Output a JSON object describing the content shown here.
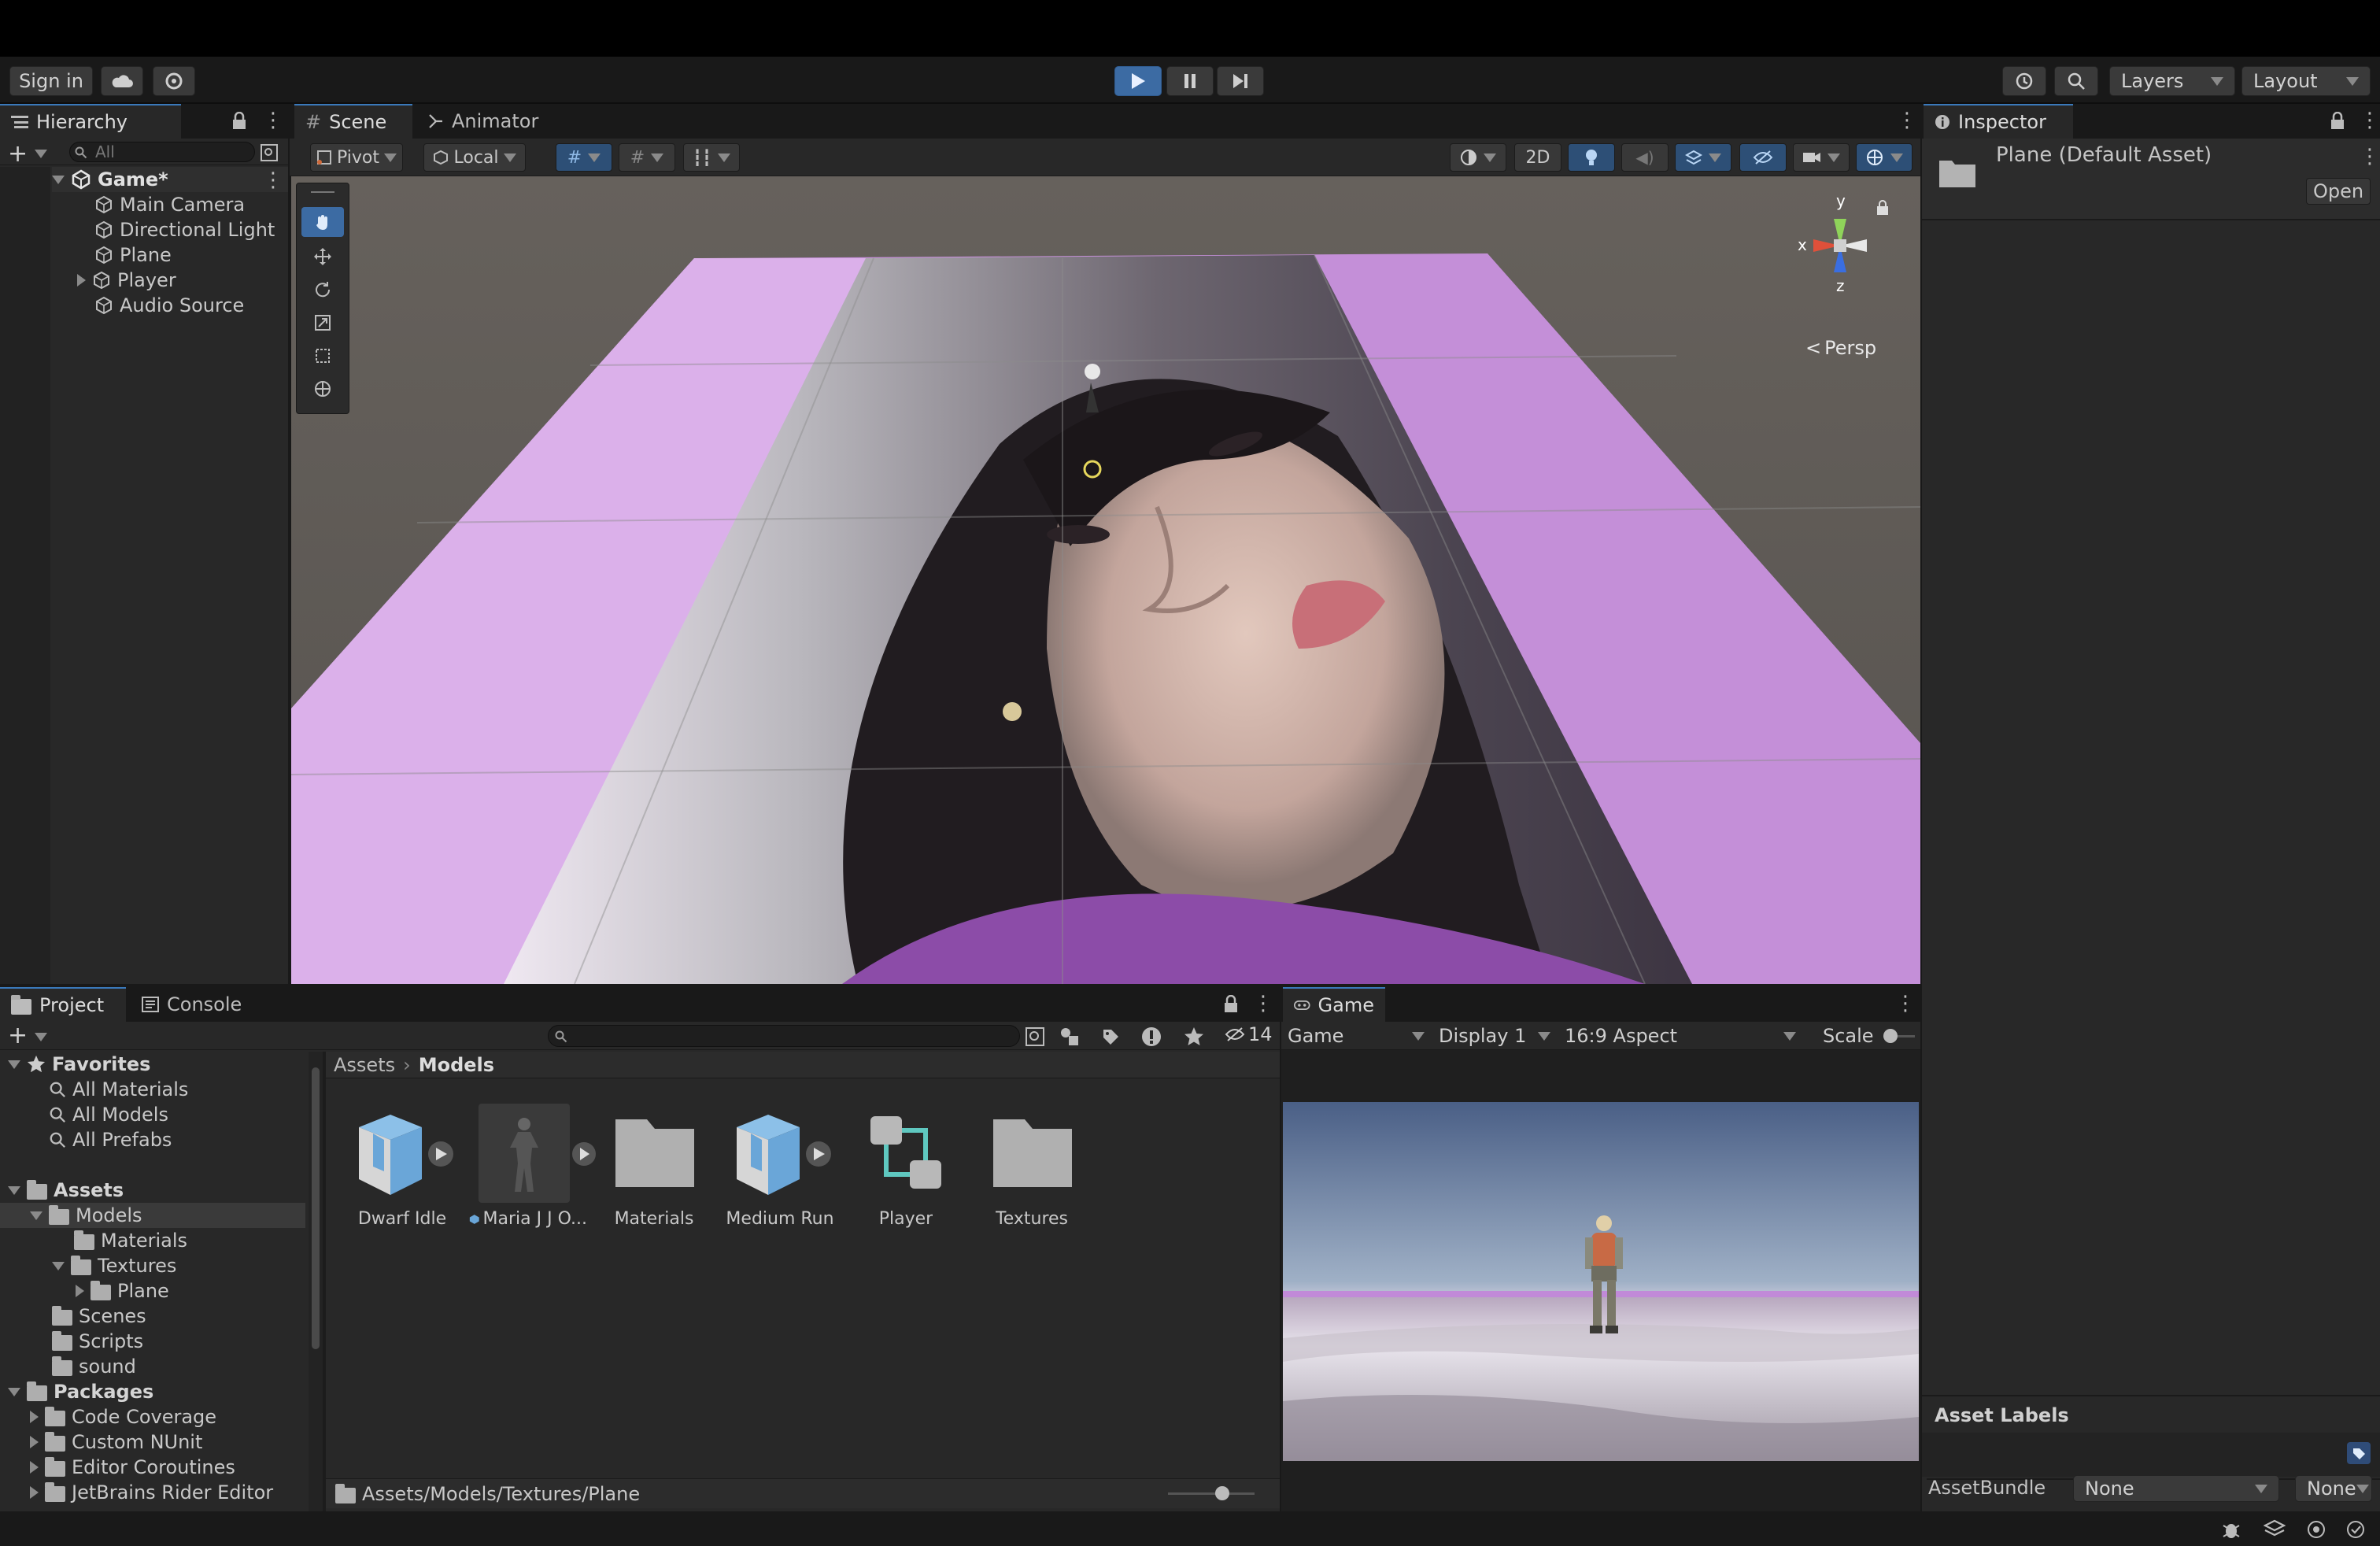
{
  "toolbar": {
    "sign_in": "Sign in",
    "layers": "Layers",
    "layout": "Layout"
  },
  "hierarchy": {
    "tab": "Hierarchy",
    "search_placeholder": "All",
    "scene": "Game*",
    "items": [
      {
        "label": "Main Camera"
      },
      {
        "label": "Directional Light"
      },
      {
        "label": "Plane"
      },
      {
        "label": "Player"
      },
      {
        "label": "Audio Source"
      }
    ]
  },
  "scene_view": {
    "tabs": [
      {
        "label": "Scene"
      },
      {
        "label": "Animator"
      }
    ],
    "pivot": "Pivot",
    "local": "Local",
    "two_d": "2D",
    "gizmo": {
      "x": "x",
      "y": "y",
      "z": "z",
      "persp": "Persp"
    },
    "colors": {
      "plane": "#c48fd8",
      "sky": "#5f5b57"
    }
  },
  "inspector": {
    "tab": "Inspector",
    "title": "Plane (Default Asset)",
    "open": "Open",
    "asset_labels": "Asset Labels",
    "asset_bundle": "AssetBundle",
    "bundle_value": "None",
    "variant_value": "None"
  },
  "project": {
    "tabs": [
      {
        "label": "Project"
      },
      {
        "label": "Console"
      }
    ],
    "hidden_count": "14",
    "favorites": {
      "label": "Favorites",
      "items": [
        {
          "label": "All Materials"
        },
        {
          "label": "All Models"
        },
        {
          "label": "All Prefabs"
        }
      ]
    },
    "assets_root": "Assets",
    "tree": [
      {
        "label": "Models"
      },
      {
        "label": "Materials"
      },
      {
        "label": "Textures"
      },
      {
        "label": "Plane"
      },
      {
        "label": "Scenes"
      },
      {
        "label": "Scripts"
      },
      {
        "label": "sound"
      }
    ],
    "packages": {
      "label": "Packages",
      "items": [
        {
          "label": "Code Coverage"
        },
        {
          "label": "Custom NUnit"
        },
        {
          "label": "Editor Coroutines"
        },
        {
          "label": "JetBrains Rider Editor"
        }
      ]
    },
    "breadcrumb": {
      "root": "Assets",
      "current": "Models"
    },
    "grid": [
      {
        "label": "Dwarf Idle"
      },
      {
        "label": "Maria J J O..."
      },
      {
        "label": "Materials"
      },
      {
        "label": "Medium Run"
      },
      {
        "label": "Player"
      },
      {
        "label": "Textures"
      }
    ],
    "path": "Assets/Models/Textures/Plane"
  },
  "game": {
    "tab": "Game",
    "display_mode": "Game",
    "display": "Display 1",
    "aspect": "16:9 Aspect",
    "scale": "Scale"
  }
}
